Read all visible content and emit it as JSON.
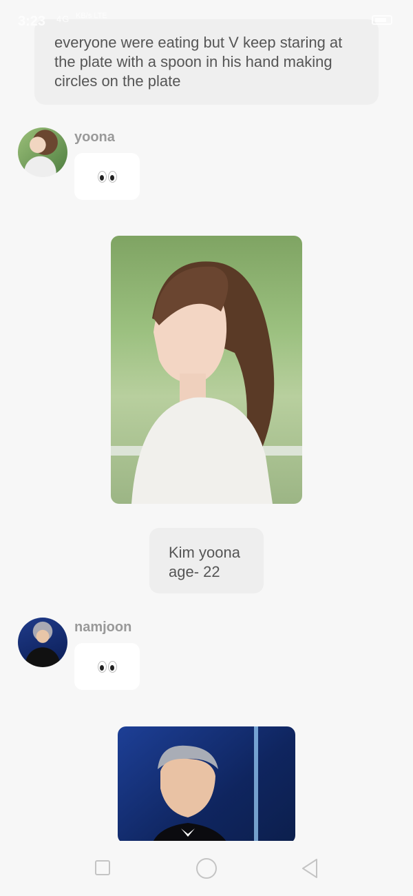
{
  "status_bar": {
    "time": "3:23",
    "signal": "4G",
    "carrier": "KB/s LTE"
  },
  "narration": {
    "text": "everyone were eating but V keep staring at the plate with a spoon in his hand making circles on the plate"
  },
  "messages": [
    {
      "sender": "yoona",
      "content_icon": "eyes-emoji",
      "photo": "yoona-portrait",
      "info_lines": [
        "Kim yoona",
        "age- 22"
      ]
    },
    {
      "sender": "namjoon",
      "content_icon": "eyes-emoji",
      "photo": "namjoon-portrait"
    }
  ],
  "nav_bar": {
    "icons": [
      "recents-square-icon",
      "home-circle-icon",
      "back-triangle-icon"
    ]
  }
}
